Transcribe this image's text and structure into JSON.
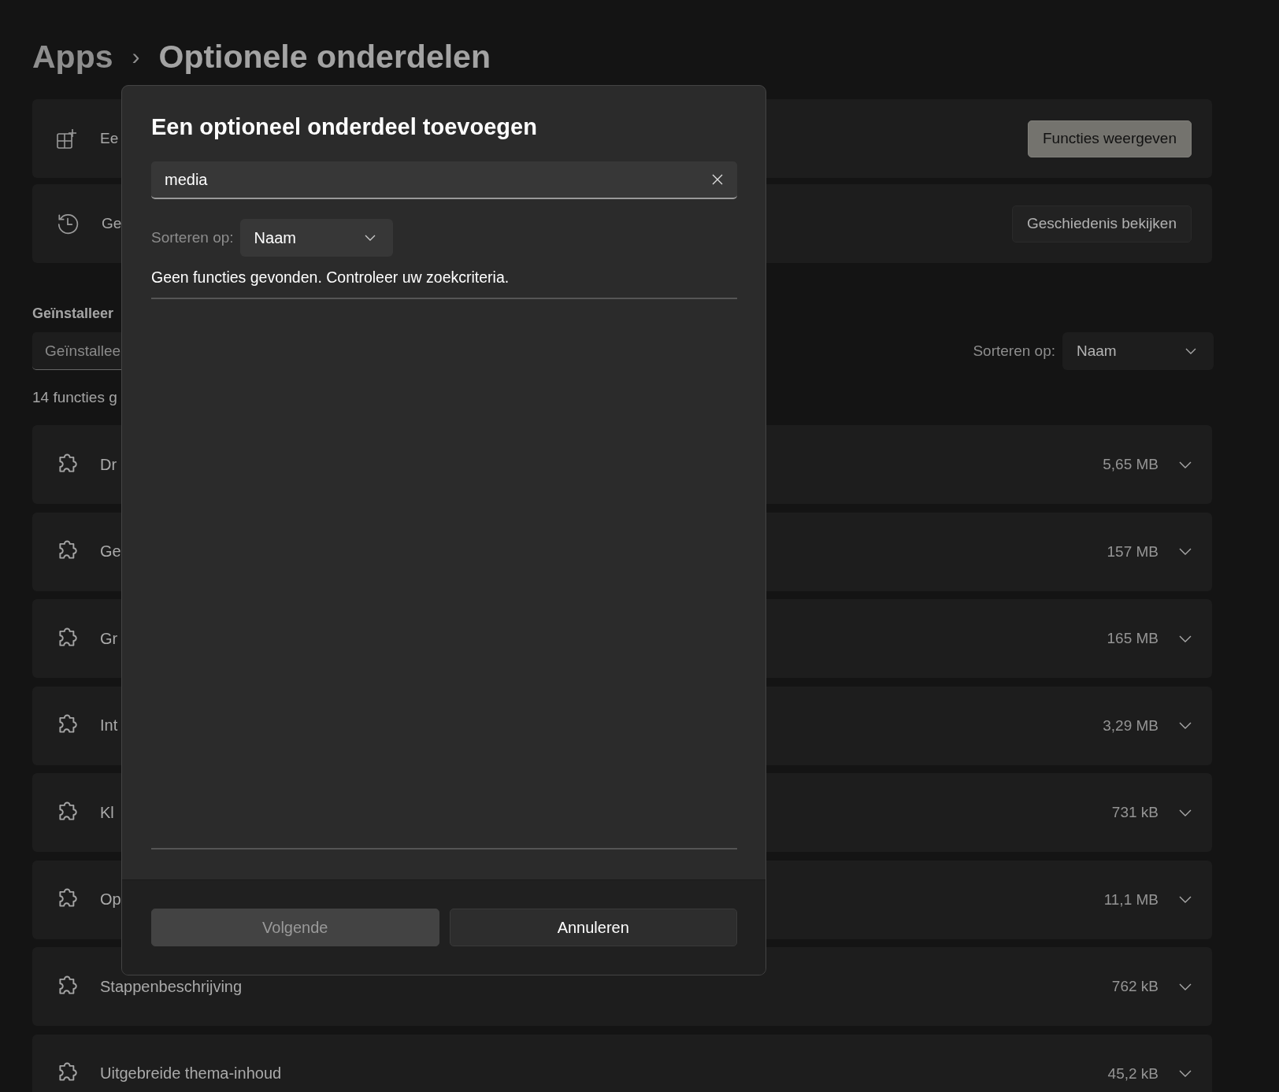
{
  "breadcrumb": {
    "parent": "Apps",
    "separator": "›",
    "current": "Optionele onderdelen"
  },
  "actions": [
    {
      "kind": "add",
      "label": "Ee",
      "button": "Functies weergeven",
      "primary": true
    },
    {
      "kind": "history",
      "label": "Ge",
      "button": "Geschiedenis bekijken",
      "primary": false
    }
  ],
  "installed": {
    "heading": "Geïnstalleer",
    "search_placeholder": "Geïnstallee",
    "sort_label": "Sorteren op:",
    "sort_value": "Naam",
    "count": "14 functies g",
    "features": [
      {
        "name": "Dr",
        "size": "5,65 MB"
      },
      {
        "name": "Ge",
        "size": "157 MB"
      },
      {
        "name": "Gr",
        "size": "165 MB"
      },
      {
        "name": "Int",
        "size": "3,29 MB"
      },
      {
        "name": "Kl",
        "size": "731 kB"
      },
      {
        "name": "Op",
        "size": "11,1 MB"
      },
      {
        "name": "Stappenbeschrijving",
        "size": "762 kB"
      },
      {
        "name": "Uitgebreide thema-inhoud",
        "size": "45,2 kB"
      }
    ]
  },
  "dialog": {
    "title": "Een optioneel onderdeel toevoegen",
    "search": {
      "value": "media"
    },
    "sort_label": "Sorteren op:",
    "sort_value": "Naam",
    "message": "Geen functies gevonden. Controleer uw zoekcriteria.",
    "buttons": [
      {
        "label": "Volgende",
        "disabled": true
      },
      {
        "label": "Annuleren",
        "disabled": false
      }
    ]
  }
}
